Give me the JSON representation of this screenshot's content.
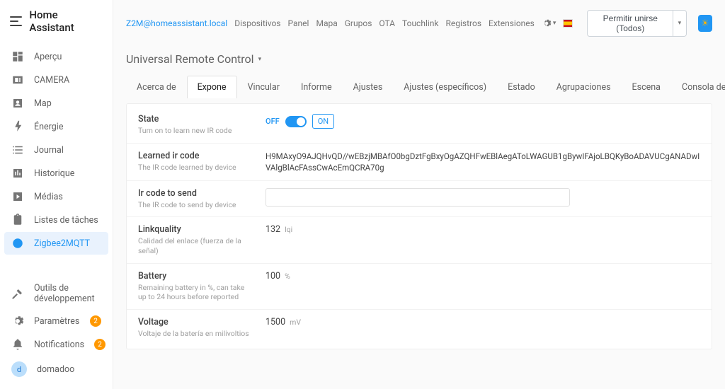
{
  "app_title": "Home Assistant",
  "sidebar": {
    "items": [
      {
        "label": "Aperçu"
      },
      {
        "label": "CAMERA"
      },
      {
        "label": "Map"
      },
      {
        "label": "Énergie"
      },
      {
        "label": "Journal"
      },
      {
        "label": "Historique"
      },
      {
        "label": "Médias"
      },
      {
        "label": "Listes de tâches"
      },
      {
        "label": "Zigbee2MQTT"
      }
    ],
    "bottom": {
      "dev_tools": "Outils de développement",
      "settings": "Paramètres",
      "settings_badge": "2",
      "notifications": "Notifications",
      "notifications_badge": "2",
      "user_initial": "d",
      "user_name": "domadoo"
    }
  },
  "topnav": {
    "email": "Z2M@homeassistant.local",
    "items": [
      "Dispositivos",
      "Panel",
      "Mapa",
      "Grupos",
      "OTA",
      "Touchlink",
      "Registros",
      "Extensiones"
    ],
    "permit_label": "Permitir unirse (Todos)"
  },
  "device": {
    "title": "Universal Remote Control",
    "tabs": [
      "Acerca de",
      "Expone",
      "Vincular",
      "Informe",
      "Ajustes",
      "Ajustes (específicos)",
      "Estado",
      "Agrupaciones",
      "Escena",
      "Consola de desarrollo"
    ],
    "active_tab": "Expone"
  },
  "expose": {
    "state": {
      "title": "State",
      "desc": "Turn on to learn new IR code",
      "off": "OFF",
      "on": "ON"
    },
    "learned": {
      "title": "Learned ir code",
      "desc": "The IR code learned by device",
      "value": "H9MAxyO9AJQHvQD//wEBzjMBAfO0bgDztFgBxyOgAZQHFwEBlAegAToLWAGUB1gBywIFAjoLBQKyBoADAVUCgANADwIVAlgBlAcFAssCwAcEmQCRA70g"
    },
    "send": {
      "title": "Ir code to send",
      "desc": "The IR code to send by device"
    },
    "linkquality": {
      "title": "Linkquality",
      "desc": "Calidad del enlace (fuerza de la señal)",
      "value": "132",
      "unit": "lqi"
    },
    "battery": {
      "title": "Battery",
      "desc": "Remaining battery in %, can take up to 24 hours before reported",
      "value": "100",
      "unit": "%"
    },
    "voltage": {
      "title": "Voltage",
      "desc": "Voltaje de la batería en milivoltios",
      "value": "1500",
      "unit": "mV"
    }
  }
}
